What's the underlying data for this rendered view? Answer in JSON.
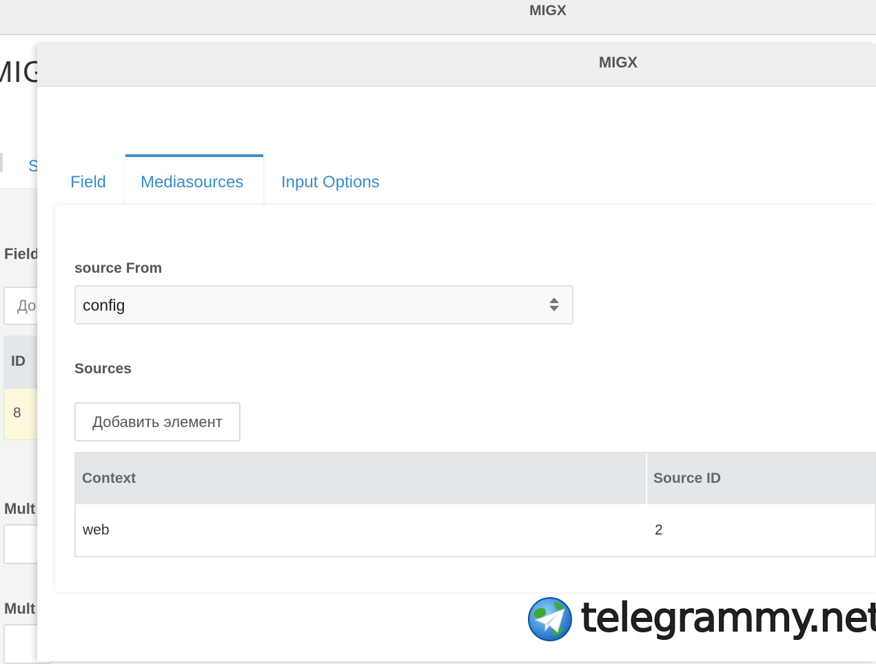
{
  "background_window": {
    "title": "MIGX",
    "heading": "MIG",
    "tab_fragment": "S",
    "fields_label": "Field",
    "add_button_fragment": "До",
    "grid_id_header": "ID",
    "grid_id_value": "8",
    "multiple_label_1": "Mult",
    "multiple_label_2": "Mult"
  },
  "modal": {
    "title": "MIGX",
    "tabs": [
      {
        "label": "Field",
        "active": false
      },
      {
        "label": "Mediasources",
        "active": true
      },
      {
        "label": "Input Options",
        "active": false
      }
    ],
    "source_from": {
      "label": "source From",
      "value": "config"
    },
    "sources": {
      "label": "Sources",
      "add_button": "Добавить элемент",
      "columns": [
        "Context",
        "Source ID"
      ],
      "rows": [
        {
          "context": "web",
          "source_id": "2"
        }
      ]
    }
  },
  "watermark": {
    "text": "telegrammy.net"
  },
  "colors": {
    "accent": "#3a91cf",
    "link": "#3a8cc9",
    "header_bg": "#e4e7ea",
    "titlebar_bg": "#efefef"
  }
}
